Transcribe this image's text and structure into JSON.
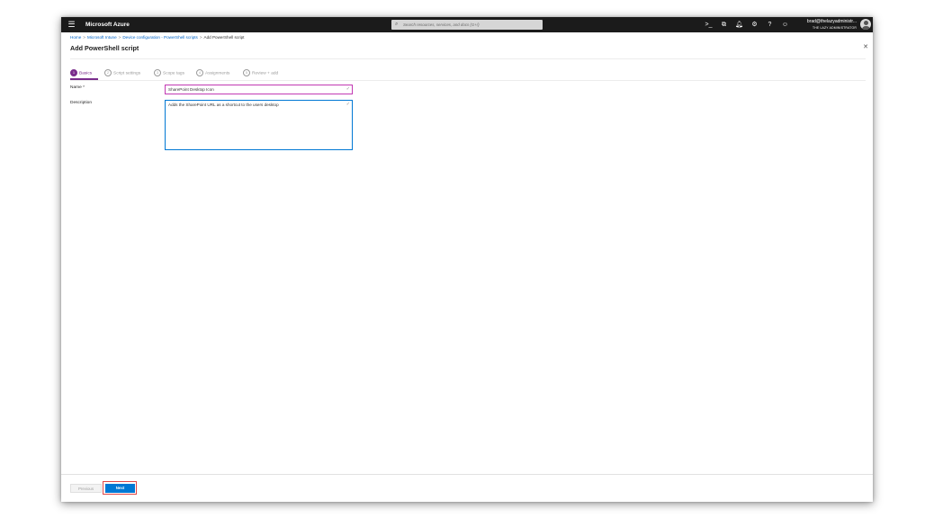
{
  "topbar": {
    "menu_icon": "hamburger-icon",
    "brand": "Microsoft Azure",
    "search_placeholder": "Search resources, services, and docs (G+/)",
    "icons": [
      "cloud-shell-icon",
      "directory-filter-icon",
      "notifications-icon",
      "settings-icon",
      "help-icon",
      "feedback-icon"
    ],
    "account_email": "brad@thelazyadministr...",
    "account_org": "THE LAZY ADMINISTRATOR"
  },
  "breadcrumb": {
    "items": [
      "Home",
      "Microsoft Intune",
      "Device configuration - PowerShell scripts",
      "Add PowerShell script"
    ],
    "separator": ">"
  },
  "page": {
    "title": "Add PowerShell script"
  },
  "tabs": [
    {
      "num": "1",
      "label": "Basics",
      "active": true
    },
    {
      "num": "2",
      "label": "Script settings",
      "active": false
    },
    {
      "num": "3",
      "label": "Scope tags",
      "active": false
    },
    {
      "num": "4",
      "label": "Assignments",
      "active": false
    },
    {
      "num": "5",
      "label": "Review + add",
      "active": false
    }
  ],
  "form": {
    "name_label": "Name *",
    "name_value": "SharePoint Desktop Icon",
    "description_label": "Description",
    "description_value": "Adds the SharePoint URL as a shortcut to the users desktop"
  },
  "footer": {
    "previous_label": "Previous",
    "next_label": "Next"
  },
  "colors": {
    "accent": "#0078d4",
    "active_tab": "#7a2d8c",
    "name_border": "#c239b3",
    "highlight": "#e04545"
  }
}
